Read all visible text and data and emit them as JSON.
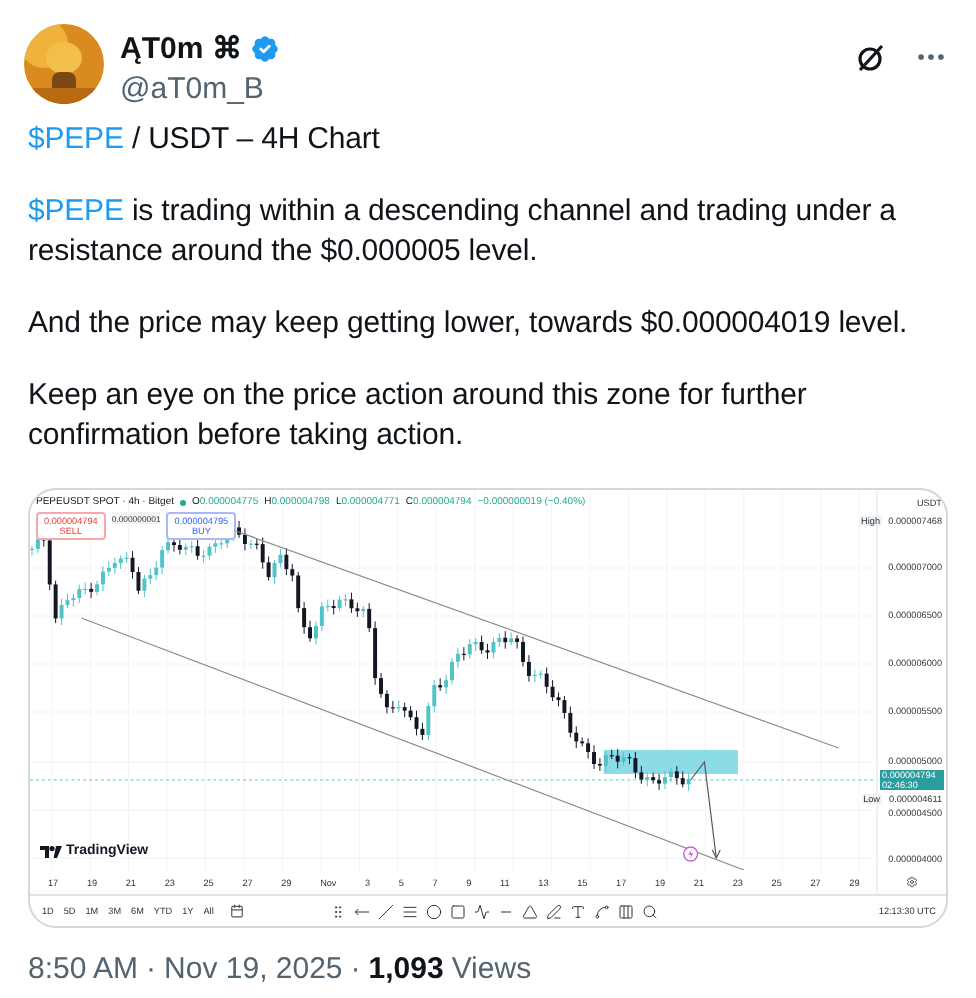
{
  "author": {
    "name": "ĄT0m ⌘",
    "handle": "@aT0m_B"
  },
  "paragraphs": [
    [
      {
        "kind": "cashtag",
        "text": "$PEPE"
      },
      {
        "kind": "plain",
        "text": " / USDT – 4H Chart"
      }
    ],
    [
      {
        "kind": "cashtag",
        "text": "$PEPE"
      },
      {
        "kind": "plain",
        "text": " is trading within a descending channel and trading under a resistance around the $0.000005 level."
      }
    ],
    [
      {
        "kind": "plain",
        "text": "And the price may keep getting lower, towards $0.000004019 level."
      }
    ],
    [
      {
        "kind": "plain",
        "text": "Keep an eye on the price action around this zone for further confirmation before taking action."
      }
    ]
  ],
  "chart": {
    "symbol": "PEPEUSDT SPOT · 4h · Bitget",
    "ohlc": [
      {
        "label": "O",
        "value": "0.000004775"
      },
      {
        "label": "H",
        "value": "0.000004798"
      },
      {
        "label": "L",
        "value": "0.000004771"
      },
      {
        "label": "C",
        "value": "0.000004794"
      }
    ],
    "change": "−0.000000019 (−0.40%)",
    "sell": {
      "price": "0.000004794",
      "label": "SELL"
    },
    "spread": "0.000000001",
    "buy": {
      "price": "0.000004795",
      "label": "BUY"
    },
    "logo": "TradingView",
    "axis": [
      {
        "kind": "unit",
        "text": "USDT"
      },
      {
        "kind": "high",
        "label": "High",
        "text": "0.000007468"
      },
      {
        "kind": "tick",
        "text": "0.000007000"
      },
      {
        "kind": "tick",
        "text": "0.000006500"
      },
      {
        "kind": "tick",
        "text": "0.000006000"
      },
      {
        "kind": "tick",
        "text": "0.000005500"
      },
      {
        "kind": "tick",
        "text": "0.000005000"
      },
      {
        "kind": "current",
        "text": "0.000004794",
        "sub": "02:46:30"
      },
      {
        "kind": "low",
        "label": "Low",
        "text": "0.000004611"
      },
      {
        "kind": "tick",
        "text": "0.000004500"
      },
      {
        "kind": "tick",
        "text": "0.000004000"
      }
    ],
    "dates": [
      "17",
      "19",
      "21",
      "23",
      "25",
      "27",
      "29",
      "Nov",
      "3",
      "5",
      "7",
      "9",
      "11",
      "13",
      "15",
      "17",
      "19",
      "21",
      "23",
      "25",
      "27",
      "29"
    ],
    "ranges": [
      "1D",
      "5D",
      "1M",
      "3M",
      "6M",
      "YTD",
      "1Y",
      "All"
    ],
    "clock": "12:13:30 UTC"
  },
  "meta": [
    {
      "kind": "plain",
      "text": "8:50 AM"
    },
    {
      "kind": "sep",
      "text": "·"
    },
    {
      "kind": "plain",
      "text": "Nov 19, 2025"
    },
    {
      "kind": "sep",
      "text": "·"
    },
    {
      "kind": "strong",
      "text": "1,093"
    },
    {
      "kind": "plain",
      "text": "Views"
    }
  ]
}
